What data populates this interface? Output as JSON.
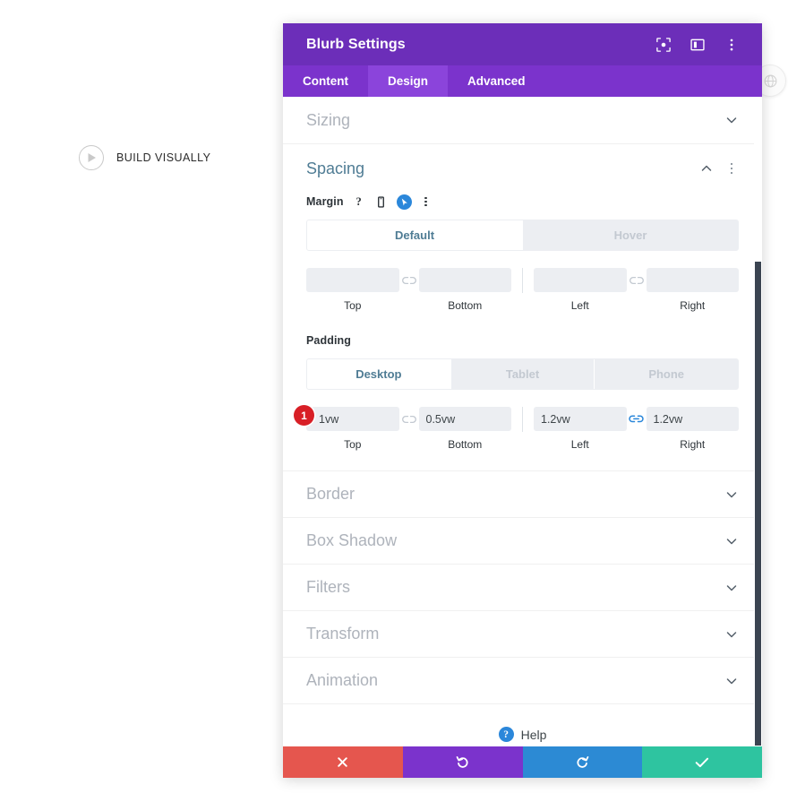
{
  "canvas": {
    "build_visually_label": "BUILD VISUALLY",
    "play_icon": "play-circle-icon",
    "edge_icon": "globe-circle-icon"
  },
  "panel": {
    "title": "Blurb Settings",
    "header_icons": [
      {
        "name": "focus-target-icon",
        "label": "Focus"
      },
      {
        "name": "panel-layout-icon",
        "label": "Layout"
      },
      {
        "name": "more-vertical-icon",
        "label": "More"
      }
    ],
    "tabs": [
      {
        "label": "Content",
        "active": false
      },
      {
        "label": "Design",
        "active": true
      },
      {
        "label": "Advanced",
        "active": false
      }
    ],
    "sections": {
      "sizing": {
        "label": "Sizing",
        "state": "collapsed",
        "chevron": "chevron-down-icon"
      },
      "spacing": {
        "label": "Spacing",
        "state": "expanded",
        "chevron": "chevron-up-icon",
        "margin": {
          "label": "Margin",
          "icons": [
            "help-question-icon",
            "mobile-device-icon",
            "hover-state-icon",
            "more-vertical-icon"
          ],
          "state_tabs": [
            {
              "label": "Default",
              "active": true
            },
            {
              "label": "Hover",
              "active": false
            }
          ],
          "fields": [
            {
              "caption": "Top",
              "value": "",
              "placeholder": ""
            },
            {
              "caption": "Bottom",
              "value": "",
              "placeholder": ""
            },
            {
              "caption": "Left",
              "value": "",
              "placeholder": ""
            },
            {
              "caption": "Right",
              "value": "",
              "placeholder": ""
            }
          ],
          "link_icons": [
            {
              "name": "link-broken-icon",
              "active": false
            },
            {
              "name": "link-broken-icon",
              "active": false
            }
          ]
        },
        "padding": {
          "label": "Padding",
          "state_tabs": [
            {
              "label": "Desktop",
              "active": true
            },
            {
              "label": "Tablet",
              "active": false
            },
            {
              "label": "Phone",
              "active": false
            }
          ],
          "badge": "1",
          "fields": [
            {
              "caption": "Top",
              "value": "1vw"
            },
            {
              "caption": "Bottom",
              "value": "0.5vw"
            },
            {
              "caption": "Left",
              "value": "1.2vw"
            },
            {
              "caption": "Right",
              "value": "1.2vw"
            }
          ],
          "link_icons": [
            {
              "name": "link-broken-icon",
              "active": false
            },
            {
              "name": "link-joined-icon",
              "active": true
            }
          ]
        }
      },
      "collapsed": [
        {
          "label": "Border",
          "chevron": "chevron-down-icon"
        },
        {
          "label": "Box Shadow",
          "chevron": "chevron-down-icon"
        },
        {
          "label": "Filters",
          "chevron": "chevron-down-icon"
        },
        {
          "label": "Transform",
          "chevron": "chevron-down-icon"
        },
        {
          "label": "Animation",
          "chevron": "chevron-down-icon"
        }
      ]
    },
    "help": {
      "label": "Help",
      "icon": "help-question-icon"
    },
    "actions": [
      {
        "name": "cancel-button",
        "icon": "close-x-icon",
        "color": "#e5564e"
      },
      {
        "name": "undo-button",
        "icon": "undo-arrow-icon",
        "color": "#7b33cc"
      },
      {
        "name": "redo-button",
        "icon": "redo-arrow-icon",
        "color": "#2c8ad4"
      },
      {
        "name": "save-button",
        "icon": "checkmark-icon",
        "color": "#2ec4a0"
      }
    ]
  },
  "colors": {
    "header_purple": "#6c2eb9",
    "tabbar_purple": "#7b33cc",
    "tab_active_purple": "#8b44db",
    "accent_blue": "#2b87da",
    "section_title": "#4f7c94",
    "badge_red": "#d81f26"
  }
}
